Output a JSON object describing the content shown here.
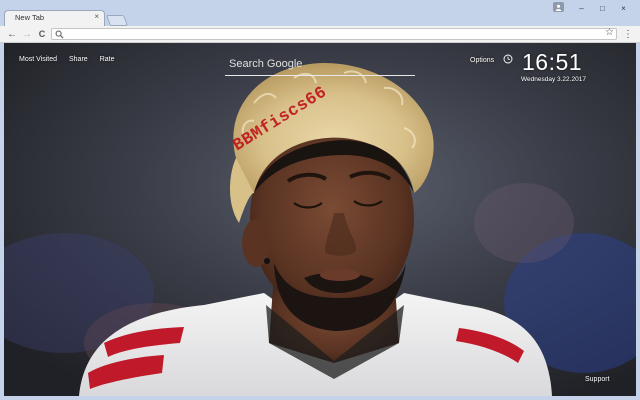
{
  "browser": {
    "tab": {
      "title": "New Tab",
      "close_symbol": "×"
    },
    "window_controls": {
      "minimize": "–",
      "maximize": "□",
      "close": "×"
    },
    "toolbar": {
      "back_symbol": "←",
      "forward_symbol": "→",
      "reload_symbol": "C",
      "omnibox_value": "",
      "bookmark_symbol": "☆",
      "menu_symbol": "⋮"
    }
  },
  "newtab": {
    "top_links": [
      {
        "label": "Most Visited"
      },
      {
        "label": "Share"
      },
      {
        "label": "Rate"
      }
    ],
    "search": {
      "placeholder": "Search Google"
    },
    "options_label": "Options",
    "clock": {
      "time": "16:51",
      "date": "Wednesday  3.22.2017"
    },
    "support_label": "Support",
    "watermark_text": "BBMfiscs66"
  },
  "colors": {
    "titlebar": "#c4d3ea",
    "watermark": "#c0121a",
    "text_light": "#ffffff"
  }
}
